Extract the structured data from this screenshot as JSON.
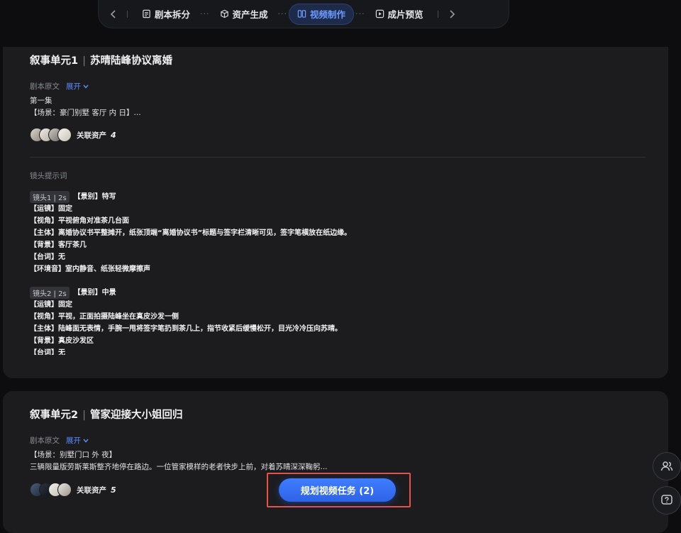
{
  "nav": {
    "steps": [
      {
        "label": "剧本拆分",
        "icon": "document-icon",
        "active": false
      },
      {
        "label": "资产生成",
        "icon": "cube-icon",
        "active": false
      },
      {
        "label": "视频制作",
        "icon": "film-icon",
        "active": true
      },
      {
        "label": "成片预览",
        "icon": "play-icon",
        "active": false
      }
    ],
    "dots": "···"
  },
  "units": [
    {
      "title_prefix": "叙事单元1",
      "title_sep": "|",
      "title": "苏晴陆峰协议离婚",
      "script_label": "剧本原文",
      "expand_label": "展开",
      "script_lines": [
        "第一集",
        "【场景：豪门别墅 客厅 内 日】..."
      ],
      "assets_label": "关联资产",
      "assets_count": "4",
      "shots_label": "镜头提示词",
      "shots": [
        {
          "tag": "镜头1 | 2s",
          "head": "【景别】特写",
          "lines": [
            "【运镜】固定",
            "【视角】平视俯角对准茶几台面",
            "【主体】离婚协议书平整摊开，纸张顶端“离婚协议书”标题与签字栏清晰可见，签字笔横放在纸边缘。",
            "【背景】客厅茶几",
            "【台词】无",
            "【环境音】室内静音、纸张轻微摩擦声"
          ]
        },
        {
          "tag": "镜头2 | 2s",
          "head": "【景别】中景",
          "lines": [
            "【运镜】固定",
            "【视角】平视，正面拍摄陆峰坐在真皮沙发一侧",
            "【主体】陆峰面无表情，手腕一甩将签字笔扔到茶几上，指节收紧后缓慢松开，目光冷冷压向苏晴。",
            "【背景】真皮沙发区",
            "【台词】无"
          ]
        }
      ]
    },
    {
      "title_prefix": "叙事单元2",
      "title_sep": "|",
      "title": "管家迎接大小姐回归",
      "script_label": "剧本原文",
      "expand_label": "展开",
      "script_lines": [
        "【场景：别墅门口 外 夜】",
        "三辆限量版劳斯莱斯整齐地停在路边。一位管家模样的老者快步上前，对着苏晴深深鞠躬..."
      ],
      "assets_label": "关联资产",
      "assets_count": "5"
    }
  ],
  "cta": {
    "label": "规划视频任务 (2)"
  },
  "colors": {
    "accent": "#3f7dff",
    "highlight": "#e0534f",
    "card": "#1c1c1f",
    "bg": "#0d0d0f"
  }
}
